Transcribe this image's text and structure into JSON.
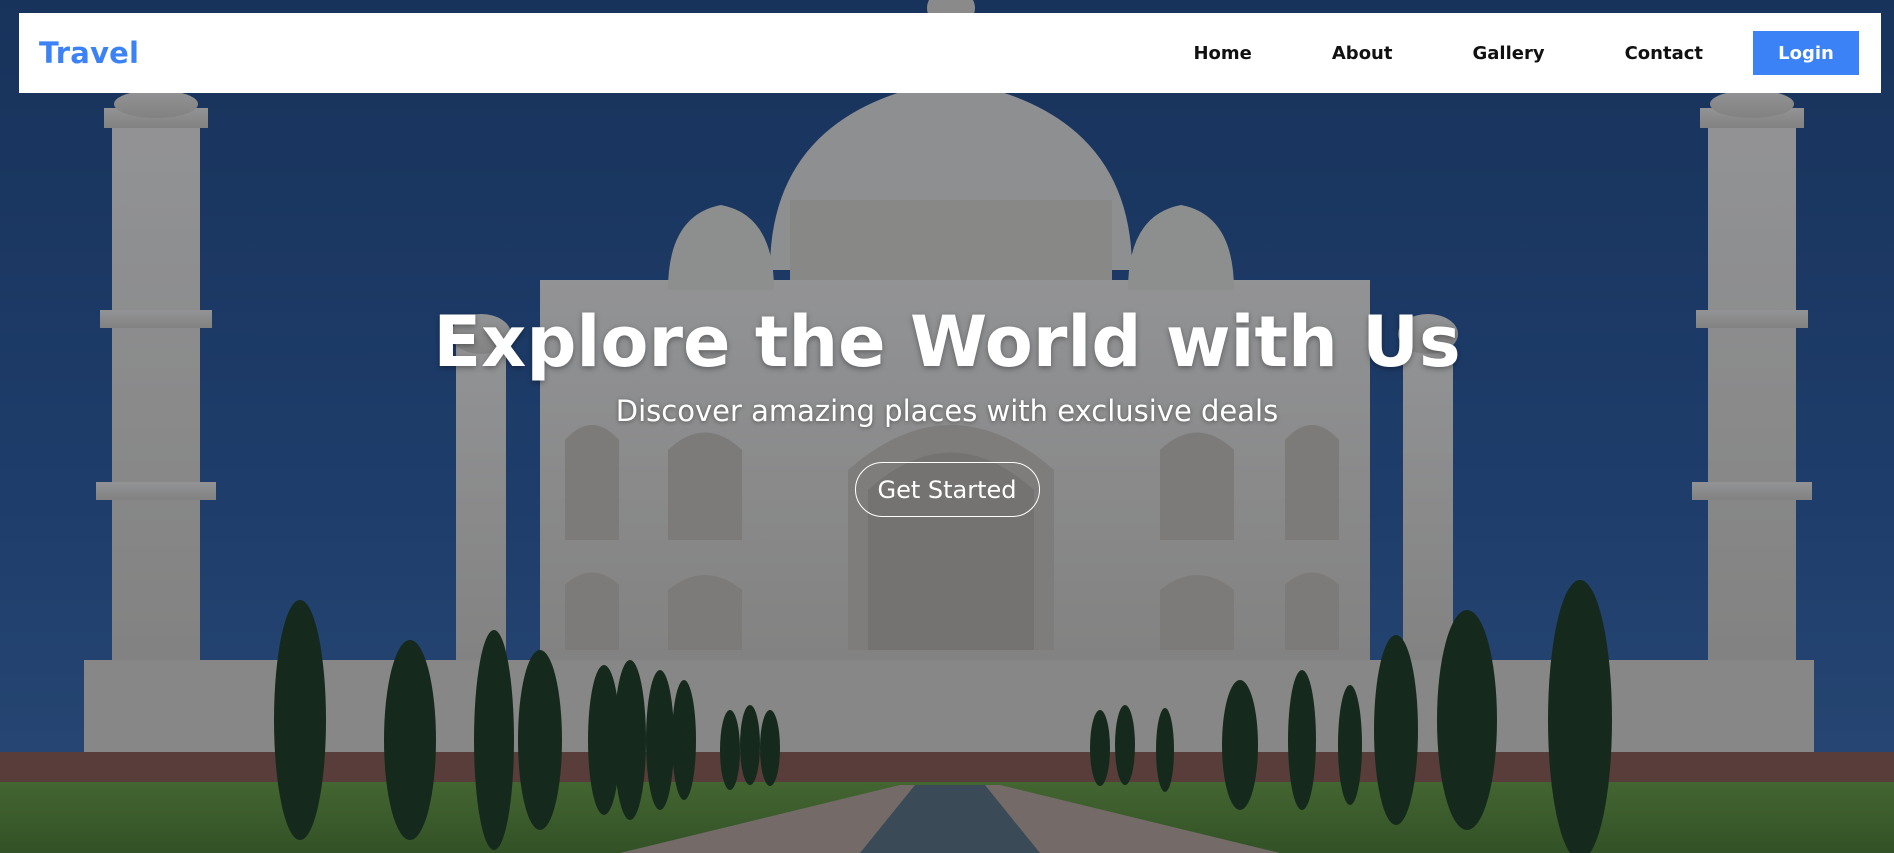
{
  "navbar": {
    "brand": "Travel",
    "links": [
      "Home",
      "About",
      "Gallery",
      "Contact"
    ],
    "login_label": "Login"
  },
  "hero": {
    "title": "Explore the World with Us",
    "subtitle": "Discover amazing places with exclusive deals",
    "cta_label": "Get Started",
    "background_scene": "taj-mahal-photo"
  },
  "colors": {
    "accent": "#3b82f6",
    "nav_bg": "#ffffff",
    "nav_text": "#111111",
    "hero_text": "#ffffff"
  }
}
